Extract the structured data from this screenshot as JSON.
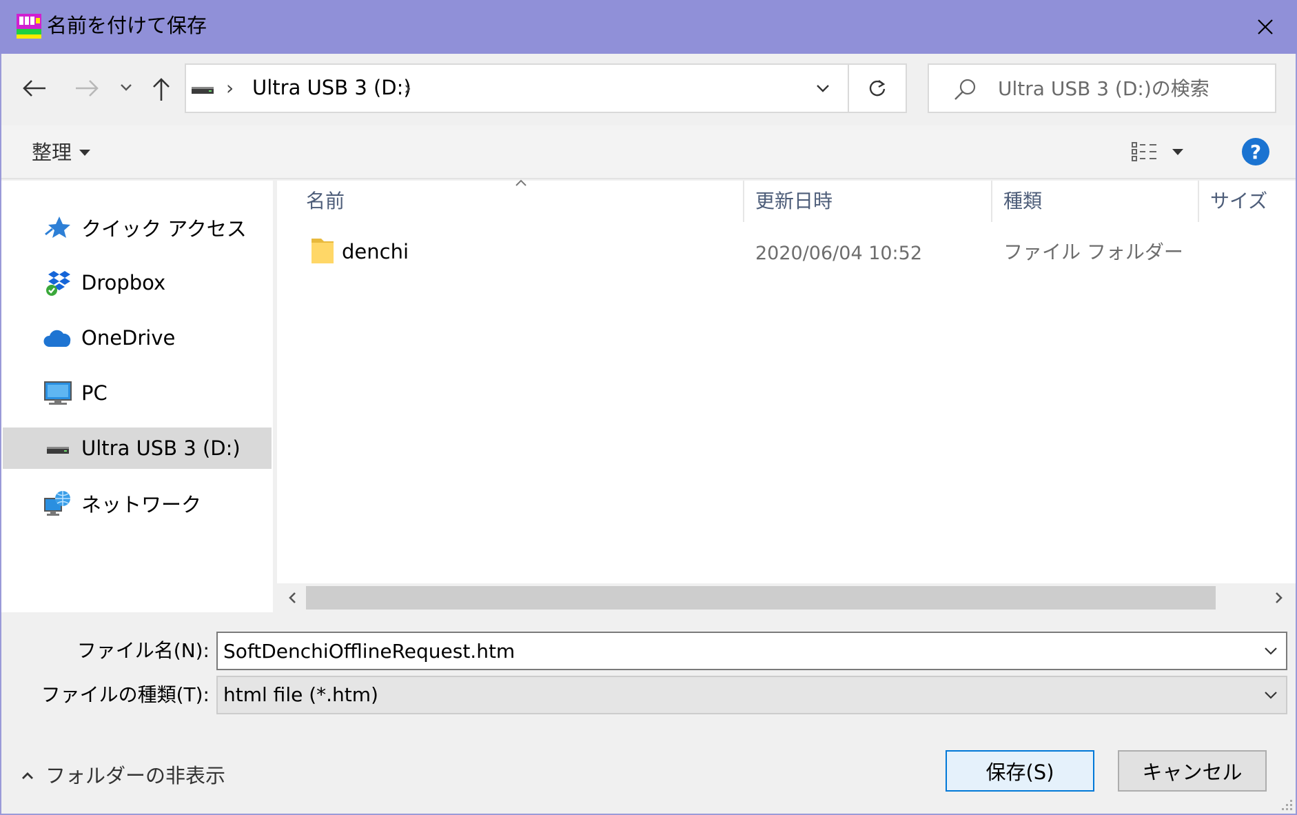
{
  "window": {
    "title": "名前を付けて保存",
    "colors": {
      "titlebar": "#9090d8",
      "selection": "#d9d9d9",
      "accent": "#0078d7"
    }
  },
  "nav_bar": {
    "back_icon": "arrow-left-icon",
    "forward_icon": "arrow-right-icon",
    "recent_icon": "chevron-down-icon",
    "up_icon": "arrow-up-icon",
    "address": {
      "drive_icon": "drive-icon",
      "segment": "Ultra USB 3 (D:)"
    },
    "refresh_icon": "refresh-icon",
    "search": {
      "placeholder": "Ultra USB 3 (D:)の検索",
      "value": ""
    }
  },
  "command_bar": {
    "organize_label": "整理",
    "view_icon": "details-view-icon",
    "help_label": "?"
  },
  "nav_pane": {
    "items": [
      {
        "label": "クイック アクセス",
        "icon": "star-icon",
        "selected": false
      },
      {
        "label": "Dropbox",
        "icon": "dropbox-icon",
        "selected": false
      },
      {
        "label": "OneDrive",
        "icon": "cloud-icon",
        "selected": false
      },
      {
        "label": "PC",
        "icon": "monitor-icon",
        "selected": false
      },
      {
        "label": "Ultra USB 3 (D:)",
        "icon": "drive-icon",
        "selected": true
      },
      {
        "label": "ネットワーク",
        "icon": "network-icon",
        "selected": false
      }
    ]
  },
  "file_list": {
    "columns": [
      "名前",
      "更新日時",
      "種類",
      "サイズ"
    ],
    "sorted_by": "名前",
    "rows": [
      {
        "name": "denchi",
        "modified": "2020/06/04 10:52",
        "type": "ファイル フォルダー",
        "size": "",
        "icon": "folder-icon"
      }
    ]
  },
  "form": {
    "filename_label": "ファイル名(N):",
    "filename_value": "SoftDenchiOfflineRequest.htm",
    "filetype_label": "ファイルの種類(T):",
    "filetype_value": "html file (*.htm)"
  },
  "footer": {
    "hide_folders_label": "フォルダーの非表示",
    "save_label": "保存(S)",
    "cancel_label": "キャンセル"
  }
}
